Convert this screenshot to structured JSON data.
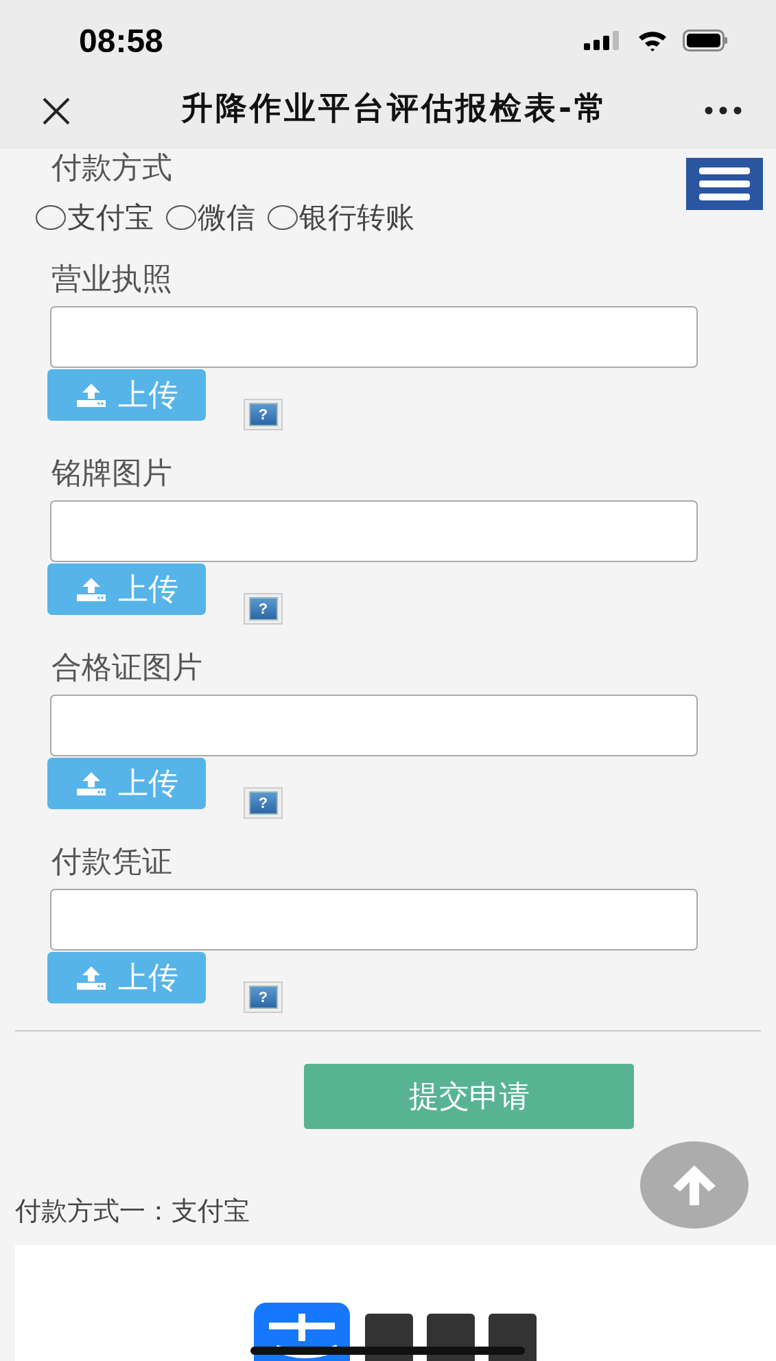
{
  "status_bar": {
    "time": "08:58"
  },
  "nav_bar": {
    "title": "升降作业平台评估报检表-常"
  },
  "payment_method": {
    "label": "付款方式",
    "options": [
      {
        "label": "支付宝",
        "selected": false
      },
      {
        "label": "微信",
        "selected": false
      },
      {
        "label": "银行转账",
        "selected": false
      }
    ]
  },
  "upload_fields": [
    {
      "label": "营业执照",
      "button": "上传",
      "help": "?"
    },
    {
      "label": "铭牌图片",
      "button": "上传",
      "help": "?"
    },
    {
      "label": "合格证图片",
      "button": "上传",
      "help": "?"
    },
    {
      "label": "付款凭证",
      "button": "上传",
      "help": "?"
    }
  ],
  "submit_button": "提交申请",
  "payment_note": "付款方式一：支付宝"
}
